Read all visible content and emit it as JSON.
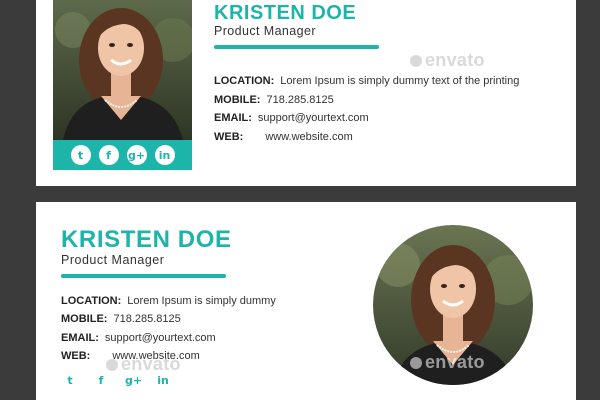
{
  "colors": {
    "accent": "#1db4a9",
    "background": "#3b3b3b",
    "card": "#ffffff"
  },
  "top_card": {
    "name": "KRISTEN DOE",
    "role": "Product Manager",
    "location_label": "LOCATION:",
    "location_value": "Lorem Ipsum is simply dummy text of the printing",
    "mobile_label": "MOBILE:",
    "mobile_value": "718.285.8125",
    "email_label": "EMAIL:",
    "email_value": "support@yourtext.com",
    "web_label": "WEB:",
    "web_value": "www.website.com",
    "social_icons": [
      "twitter-icon",
      "facebook-icon",
      "google-plus-icon",
      "linkedin-icon"
    ],
    "social_glyphs": [
      "t",
      "f",
      "g+",
      "in"
    ]
  },
  "bottom_card": {
    "name": "KRISTEN DOE",
    "role": "Product Manager",
    "location_label": "LOCATION:",
    "location_value": "Lorem Ipsum is simply dummy",
    "mobile_label": "MOBILE:",
    "mobile_value": "718.285.8125",
    "email_label": "EMAIL:",
    "email_value": "support@yourtext.com",
    "web_label": "WEB:",
    "web_value": "www.website.com",
    "social_icons": [
      "twitter-icon",
      "facebook-icon",
      "google-plus-icon",
      "linkedin-icon"
    ],
    "social_glyphs": [
      "t",
      "f",
      "g+",
      "in"
    ]
  },
  "watermark": "envato"
}
